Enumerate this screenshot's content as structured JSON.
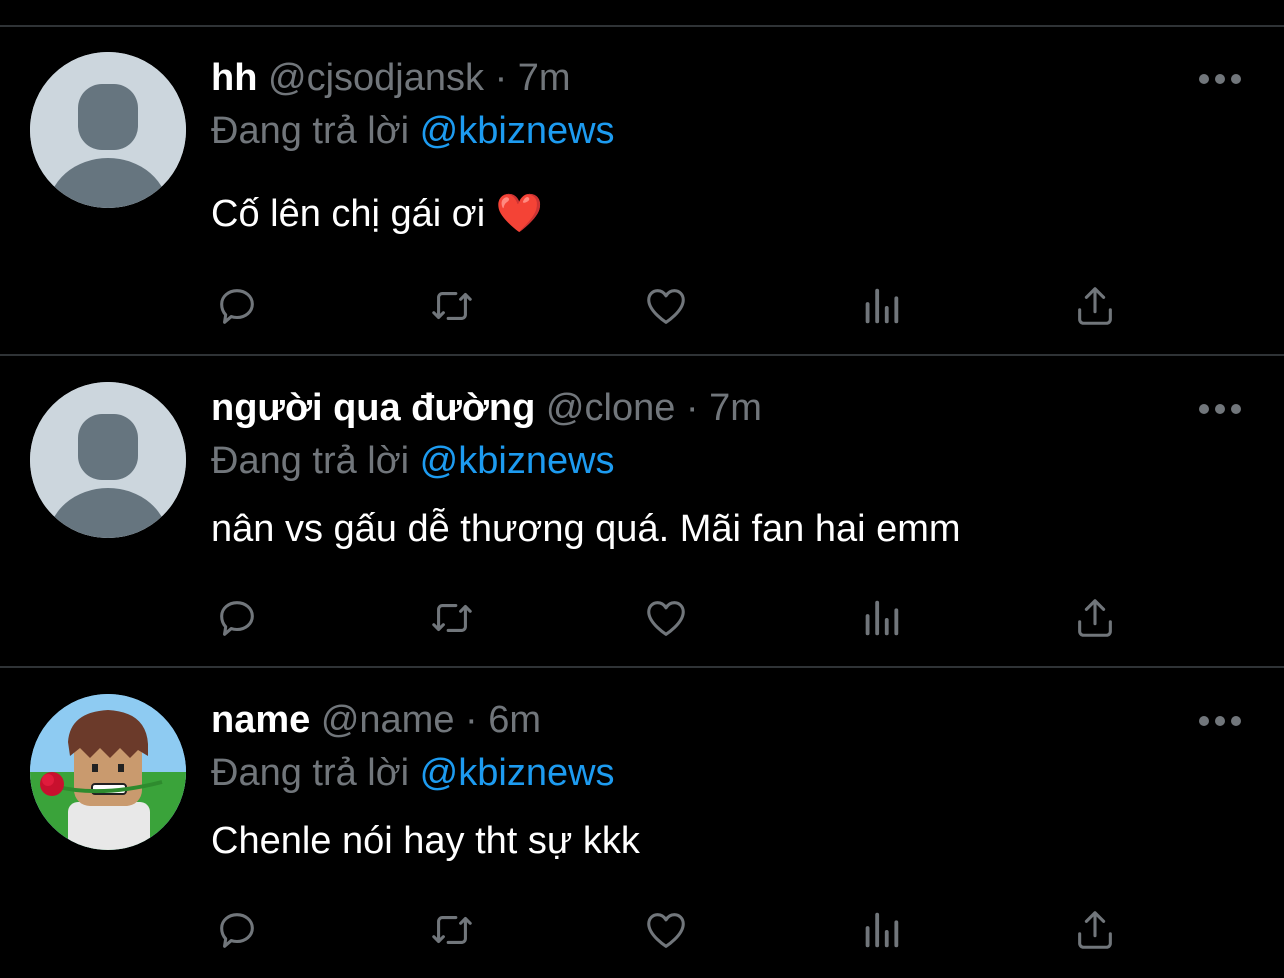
{
  "tweets": [
    {
      "name": "hh",
      "handle": "@cjsodjansk",
      "dot": "·",
      "time": "7m",
      "replying_prefix": "Đang trả lời",
      "replying_to": "@kbiznews",
      "text": "Cố lên chị gái ơi ",
      "emoji": "❤️",
      "avatar": "default-avatar"
    },
    {
      "name": "người qua đường",
      "handle": "@clone",
      "dot": "·",
      "time": "7m",
      "replying_prefix": "Đang trả lời",
      "replying_to": "@kbiznews",
      "text": "nân vs gấu dễ thương quá. Mãi fan hai emm",
      "emoji": "",
      "avatar": "default-avatar"
    },
    {
      "name": "name",
      "handle": "@name",
      "dot": "·",
      "time": "6m",
      "replying_prefix": "Đang trả lời",
      "replying_to": "@kbiznews",
      "text": "Chenle nói hay tht sự kkk",
      "emoji": "",
      "avatar": "roblox-character-with-rose"
    }
  ],
  "icons": {
    "reply": "reply-icon",
    "retweet": "retweet-icon",
    "like": "heart-icon",
    "views": "analytics-icon",
    "share": "share-icon",
    "more": "more-icon"
  },
  "colors": {
    "background": "#000000",
    "name": "#ffffff",
    "secondary": "#71767b",
    "mention": "#1d9bf0",
    "divider": "#2f3336"
  }
}
